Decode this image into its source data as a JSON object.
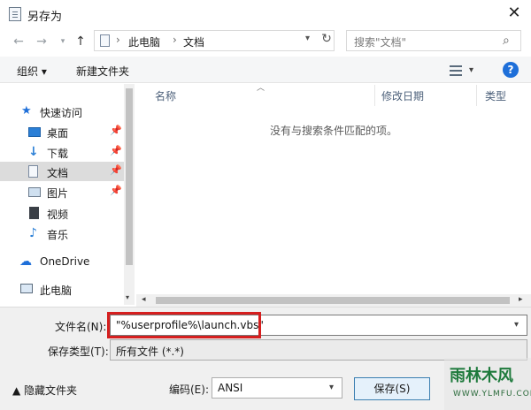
{
  "window": {
    "title": "另存为",
    "close_glyph": "✕"
  },
  "address_bar": {
    "crumbs": [
      "此电脑",
      "文档"
    ],
    "separator": "›",
    "search_placeholder": "搜索\"文档\""
  },
  "toolbar": {
    "organize_label": "组织 ▾",
    "new_folder_label": "新建文件夹",
    "help_glyph": "?"
  },
  "nav_pane": {
    "items": [
      {
        "label": "快速访问",
        "icon": "star-icon",
        "pinned": false,
        "selected": false
      },
      {
        "label": "桌面",
        "icon": "desktop-icon",
        "pinned": true,
        "selected": false
      },
      {
        "label": "下载",
        "icon": "download-icon",
        "pinned": true,
        "selected": false
      },
      {
        "label": "文档",
        "icon": "document-icon",
        "pinned": true,
        "selected": true
      },
      {
        "label": "图片",
        "icon": "picture-icon",
        "pinned": true,
        "selected": false
      },
      {
        "label": "视频",
        "icon": "video-icon",
        "pinned": false,
        "selected": false
      },
      {
        "label": "音乐",
        "icon": "music-icon",
        "pinned": false,
        "selected": false
      },
      {
        "label": "OneDrive",
        "icon": "cloud-icon",
        "pinned": false,
        "selected": false
      },
      {
        "label": "此电脑",
        "icon": "computer-icon",
        "pinned": false,
        "selected": false
      }
    ]
  },
  "file_list": {
    "columns": [
      "名称",
      "修改日期",
      "类型"
    ],
    "empty_message": "没有与搜索条件匹配的项。"
  },
  "form": {
    "filename_label": "文件名(N):",
    "filename_value": "\"%userprofile%\\launch.vbs\"",
    "filetype_label": "保存类型(T):",
    "filetype_value": "所有文件  (*.*)",
    "encoding_label": "编码(E):",
    "encoding_value": "ANSI",
    "save_label": "保存(S)",
    "hide_folders_label": "▲ 隐藏文件夹"
  },
  "watermark": {
    "text": "雨林木风",
    "sub": "WWW.YLMFU.COM"
  },
  "colors": {
    "accent": "#1e6fd9",
    "highlight_border": "#d61f1f",
    "selected_bg": "#dcdcdc"
  }
}
